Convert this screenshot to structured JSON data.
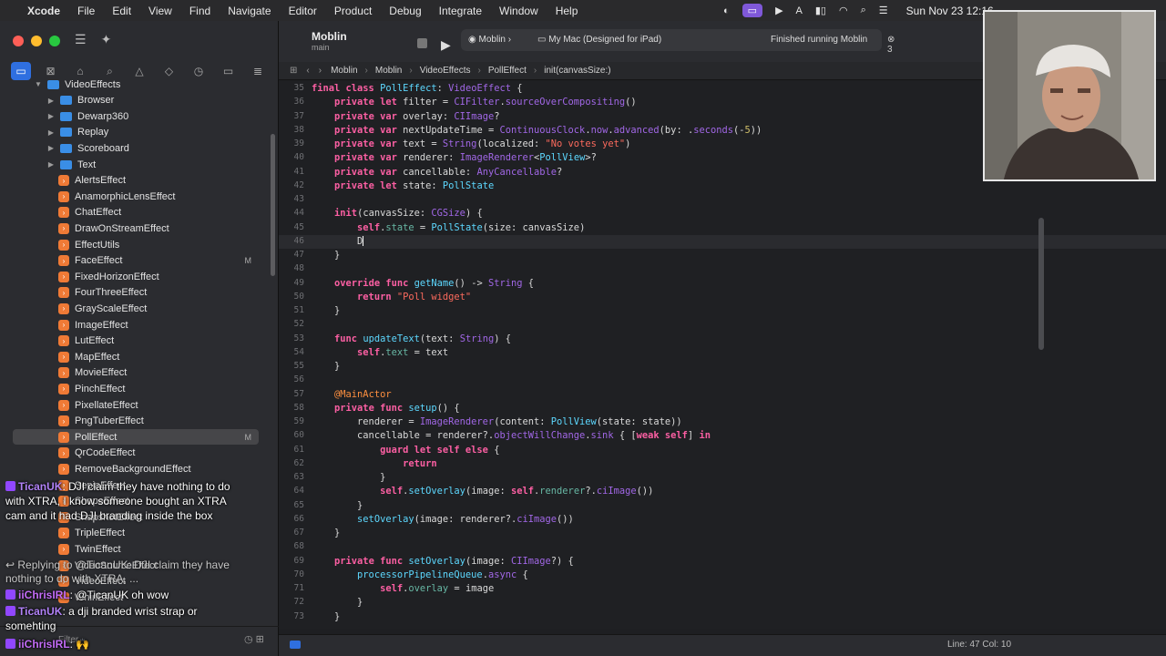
{
  "menubar": {
    "app": "Xcode",
    "items": [
      "File",
      "Edit",
      "View",
      "Find",
      "Navigate",
      "Editor",
      "Product",
      "Debug",
      "Integrate",
      "Window",
      "Help"
    ],
    "clock": "Sun Nov 23 12:16"
  },
  "toolbar": {
    "project": "Moblin",
    "branch": "main",
    "scheme": "Moblin",
    "destination": "My Mac (Designed for iPad)",
    "status": "Finished running Moblin",
    "issues": "3"
  },
  "jumpbar": [
    "Moblin",
    "Moblin",
    "VideoEffects",
    "PollEffect",
    "init(canvasSize:)"
  ],
  "tree": [
    {
      "label": "VideoEffects",
      "kind": "folder",
      "open": true,
      "indent": 0
    },
    {
      "label": "Browser",
      "kind": "folder",
      "indent": 1
    },
    {
      "label": "Dewarp360",
      "kind": "folder",
      "indent": 1
    },
    {
      "label": "Replay",
      "kind": "folder",
      "indent": 1
    },
    {
      "label": "Scoreboard",
      "kind": "folder",
      "indent": 1
    },
    {
      "label": "Text",
      "kind": "folder",
      "indent": 1
    },
    {
      "label": "AlertsEffect",
      "kind": "swift",
      "indent": 1
    },
    {
      "label": "AnamorphicLensEffect",
      "kind": "swift",
      "indent": 1
    },
    {
      "label": "ChatEffect",
      "kind": "swift",
      "indent": 1
    },
    {
      "label": "DrawOnStreamEffect",
      "kind": "swift",
      "indent": 1
    },
    {
      "label": "EffectUtils",
      "kind": "swift",
      "indent": 1
    },
    {
      "label": "FaceEffect",
      "kind": "swift",
      "indent": 1,
      "badge": "M"
    },
    {
      "label": "FixedHorizonEffect",
      "kind": "swift",
      "indent": 1
    },
    {
      "label": "FourThreeEffect",
      "kind": "swift",
      "indent": 1
    },
    {
      "label": "GrayScaleEffect",
      "kind": "swift",
      "indent": 1
    },
    {
      "label": "ImageEffect",
      "kind": "swift",
      "indent": 1
    },
    {
      "label": "LutEffect",
      "kind": "swift",
      "indent": 1
    },
    {
      "label": "MapEffect",
      "kind": "swift",
      "indent": 1
    },
    {
      "label": "MovieEffect",
      "kind": "swift",
      "indent": 1
    },
    {
      "label": "PinchEffect",
      "kind": "swift",
      "indent": 1
    },
    {
      "label": "PixellateEffect",
      "kind": "swift",
      "indent": 1
    },
    {
      "label": "PngTuberEffect",
      "kind": "swift",
      "indent": 1
    },
    {
      "label": "PollEffect",
      "kind": "swift",
      "indent": 1,
      "badge": "M",
      "selected": true
    },
    {
      "label": "QrCodeEffect",
      "kind": "swift",
      "indent": 1
    },
    {
      "label": "RemoveBackgroundEffect",
      "kind": "swift",
      "indent": 1
    },
    {
      "label": "SepiaEffect",
      "kind": "swift",
      "indent": 1
    },
    {
      "label": "ShapeEffect",
      "kind": "swift",
      "indent": 1
    },
    {
      "label": "SnapshotEffect",
      "kind": "swift",
      "indent": 1
    },
    {
      "label": "TripleEffect",
      "kind": "swift",
      "indent": 1
    },
    {
      "label": "TwinEffect",
      "kind": "swift",
      "indent": 1
    },
    {
      "label": "VideoSourceEffect",
      "kind": "swift",
      "indent": 1
    },
    {
      "label": "VideoEffect",
      "kind": "swift",
      "indent": 1
    },
    {
      "label": "WhirlEffect",
      "kind": "swift",
      "indent": 1
    }
  ],
  "filter_placeholder": "Filter",
  "code": [
    {
      "n": "35",
      "html": "<span class='k'>final class</span> <span class='t'>PollEffect</span>: <span class='p'>VideoEffect</span> {"
    },
    {
      "n": "36",
      "html": "    <span class='k'>private let</span> filter = <span class='p'>CIFilter</span>.<span class='p'>sourceOverCompositing</span>()"
    },
    {
      "n": "37",
      "html": "    <span class='k'>private var</span> overlay: <span class='p'>CIImage</span>?"
    },
    {
      "n": "38",
      "html": "    <span class='k'>private var</span> nextUpdateTime = <span class='p'>ContinuousClock</span>.<span class='p'>now</span>.<span class='p'>advanced</span>(by: .<span class='p'>seconds</span>(-<span class='n'>5</span>))"
    },
    {
      "n": "39",
      "html": "    <span class='k'>private var</span> text = <span class='p'>String</span>(localized: <span class='s'>\"No votes yet\"</span>)"
    },
    {
      "n": "40",
      "html": "    <span class='k'>private var</span> renderer: <span class='p'>ImageRenderer</span>&lt;<span class='t'>PollView</span>&gt;?"
    },
    {
      "n": "41",
      "html": "    <span class='k'>private var</span> cancellable: <span class='p'>AnyCancellable</span>?"
    },
    {
      "n": "42",
      "html": "    <span class='k'>private let</span> state: <span class='t'>PollState</span>"
    },
    {
      "n": "43",
      "html": ""
    },
    {
      "n": "44",
      "html": "    <span class='k'>init</span>(canvasSize: <span class='p'>CGSize</span>) {"
    },
    {
      "n": "45",
      "html": "        <span class='k'>self</span>.<span class='f'>state</span> = <span class='t'>PollState</span>(size: canvasSize)"
    },
    {
      "n": "46",
      "html": "        D<span class='caret'></span>",
      "current": true
    },
    {
      "n": "47",
      "html": "    }"
    },
    {
      "n": "48",
      "html": ""
    },
    {
      "n": "49",
      "html": "    <span class='k'>override func</span> <span class='t'>getName</span>() -&gt; <span class='p'>String</span> {"
    },
    {
      "n": "50",
      "html": "        <span class='k'>return</span> <span class='s'>\"Poll widget\"</span>"
    },
    {
      "n": "51",
      "html": "    }"
    },
    {
      "n": "52",
      "html": ""
    },
    {
      "n": "53",
      "html": "    <span class='k'>func</span> <span class='t'>updateText</span>(text: <span class='p'>String</span>) {"
    },
    {
      "n": "54",
      "html": "        <span class='k'>self</span>.<span class='f'>text</span> = text"
    },
    {
      "n": "55",
      "html": "    }"
    },
    {
      "n": "56",
      "html": ""
    },
    {
      "n": "57",
      "html": "    <span class='a'>@MainActor</span>"
    },
    {
      "n": "58",
      "html": "    <span class='k'>private func</span> <span class='t'>setup</span>() {"
    },
    {
      "n": "59",
      "html": "        renderer = <span class='p'>ImageRenderer</span>(content: <span class='t'>PollView</span>(state: state))"
    },
    {
      "n": "60",
      "html": "        cancellable = renderer?.<span class='p'>objectWillChange</span>.<span class='p'>sink</span> { [<span class='k'>weak self</span>] <span class='k'>in</span>"
    },
    {
      "n": "61",
      "html": "            <span class='k'>guard let self else</span> {"
    },
    {
      "n": "62",
      "html": "                <span class='k'>return</span>"
    },
    {
      "n": "63",
      "html": "            }"
    },
    {
      "n": "64",
      "html": "            <span class='k'>self</span>.<span class='t'>setOverlay</span>(image: <span class='k'>self</span>.<span class='f'>renderer</span>?.<span class='p'>ciImage</span>())"
    },
    {
      "n": "65",
      "html": "        }"
    },
    {
      "n": "66",
      "html": "        <span class='t'>setOverlay</span>(image: renderer?.<span class='p'>ciImage</span>())"
    },
    {
      "n": "67",
      "html": "    }"
    },
    {
      "n": "68",
      "html": ""
    },
    {
      "n": "69",
      "html": "    <span class='k'>private func</span> <span class='t'>setOverlay</span>(image: <span class='p'>CIImage</span>?) {"
    },
    {
      "n": "70",
      "html": "        <span class='t'>processorPipelineQueue</span>.<span class='p'>async</span> {"
    },
    {
      "n": "71",
      "html": "            <span class='k'>self</span>.<span class='f'>overlay</span> = image"
    },
    {
      "n": "72",
      "html": "        }"
    },
    {
      "n": "73",
      "html": "    }"
    }
  ],
  "status": {
    "position": "Line: 47  Col: 10"
  },
  "chat": [
    {
      "user": "TicanUK",
      "text": "DJI claim they have nothing to do with XTRA, I know someone bought an XTRA cam and it had DJI branding inside the box"
    },
    {
      "reply": "Replying to @TicanUK: DJI claim they have nothing to do with XTRA, ..."
    },
    {
      "user": "iiChrisIRL",
      "text": "@TicanUK oh wow"
    },
    {
      "user": "TicanUK",
      "text": "a dji branded wrist strap or somehting"
    },
    {
      "user": "iiChrisIRL",
      "text": "🙌"
    }
  ]
}
